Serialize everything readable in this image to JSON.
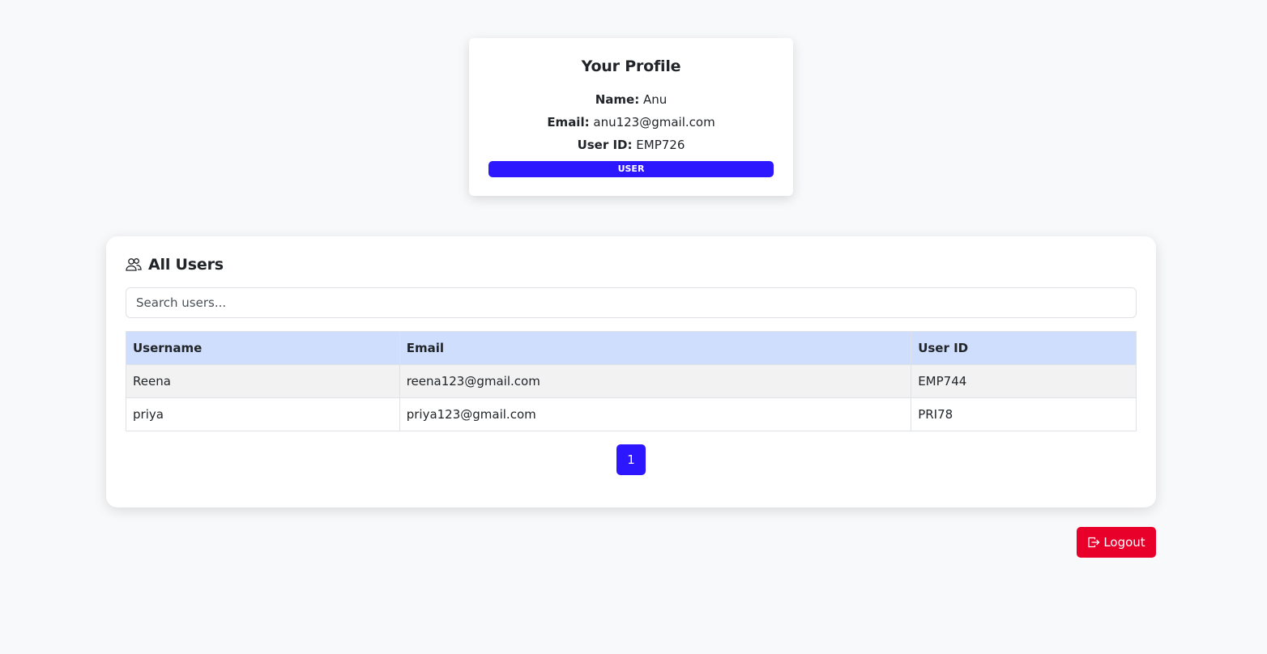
{
  "profile": {
    "title": "Your Profile",
    "name_label": "Name:",
    "name_value": "Anu",
    "email_label": "Email:",
    "email_value": "anu123@gmail.com",
    "userid_label": "User ID:",
    "userid_value": "EMP726",
    "role_badge": "USER",
    "role_badge_color": "#2d17ff"
  },
  "users_section": {
    "icon": "users-icon",
    "title": "All Users",
    "search_placeholder": "Search users...",
    "table": {
      "columns": [
        "Username",
        "Email",
        "User ID"
      ],
      "rows": [
        {
          "username": "Reena",
          "email": "reena123@gmail.com",
          "user_id": "EMP744"
        },
        {
          "username": "priya",
          "email": "priya123@gmail.com",
          "user_id": "PRI78"
        }
      ],
      "header_color": "#cfdefc"
    },
    "pagination": {
      "current_page": "1",
      "accent_color": "#2d17ff"
    }
  },
  "logout": {
    "icon": "logout-icon",
    "label": "Logout",
    "color": "#e8002a"
  }
}
